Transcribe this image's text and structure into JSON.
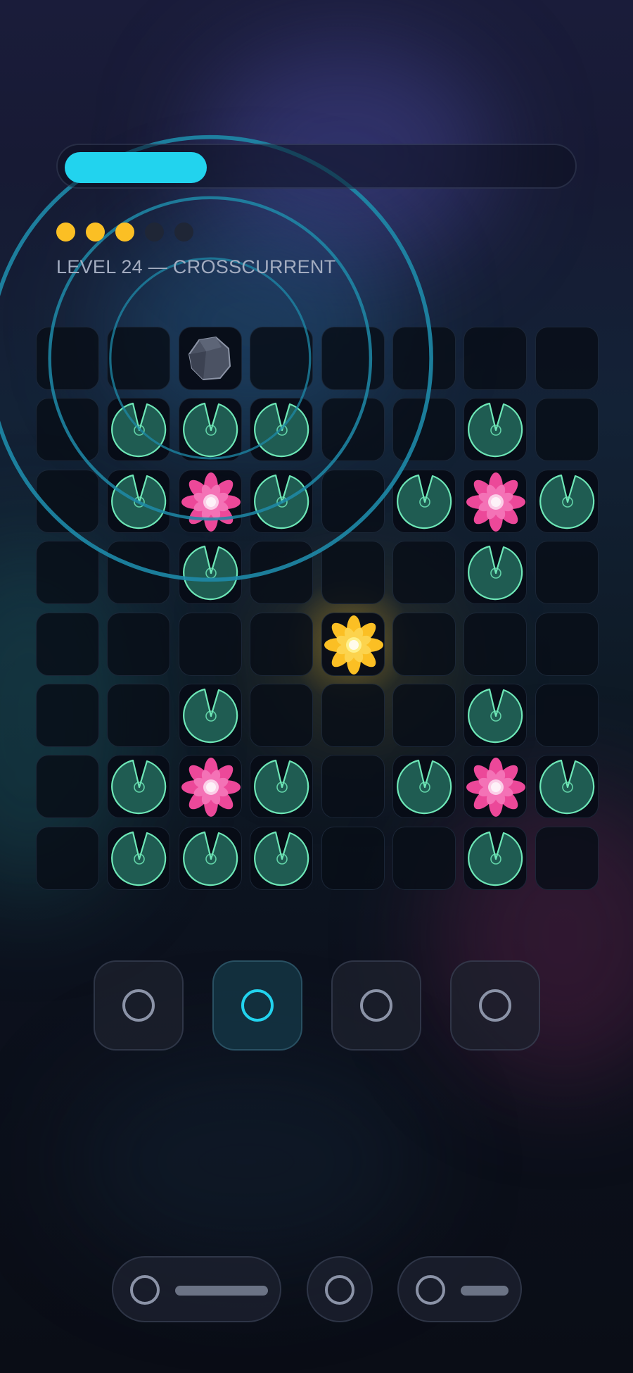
{
  "progress": {
    "fraction": 0.28
  },
  "stars": {
    "earned": 3,
    "total": 5,
    "on_color": "#fbbf24",
    "off_color": "#1f2636"
  },
  "level": {
    "title": "LEVEL 24 — CROSSCURRENT"
  },
  "colors": {
    "accent": "#22d3ee",
    "lily_pad": "#1f5c52",
    "lily_pad_edge": "#6ee7b7",
    "lotus_pink": "#ec4899",
    "lotus_gold": "#fbbf24",
    "ripple": "#1e8aa8"
  },
  "board": {
    "rows": 8,
    "cols": 8,
    "legend": {
      ".": "empty",
      "P": "lily-pad",
      "F": "pink-lotus",
      "G": "gold-lotus",
      "R": "rock"
    },
    "grid": [
      "..R.....",
      ".PPP..P.",
      ".PFP.PFP",
      "..P...P.",
      "....G...",
      "..P...P.",
      ".PFP.PFP",
      ".PPP..P."
    ]
  },
  "ripple": {
    "center_row": 0.5,
    "center_col": 2.5,
    "radii_in_cells": [
      1.4,
      2.25,
      3.1
    ]
  },
  "tools": [
    {
      "icon": "ring-icon",
      "selected": false
    },
    {
      "icon": "ring-icon",
      "selected": true
    },
    {
      "icon": "ring-icon",
      "selected": false
    },
    {
      "icon": "ring-icon",
      "selected": false
    }
  ],
  "bottom_bar": [
    {
      "icon": "ring-icon",
      "has_label_bar": true
    },
    {
      "icon": "ring-icon",
      "has_label_bar": false
    },
    {
      "icon": "ring-icon",
      "has_label_bar": true
    }
  ]
}
